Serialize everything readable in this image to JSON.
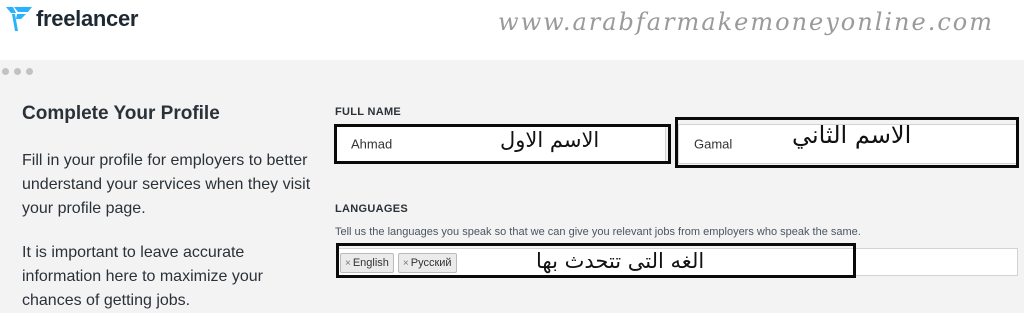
{
  "header": {
    "logo_text": "freelancer",
    "watermark": "www.arabfarmakemoneyonline.com"
  },
  "left": {
    "title": "Complete Your Profile",
    "para1": "Fill in your profile for employers to better understand your services when they visit your profile page.",
    "para2": "It is important to leave accurate information here to maximize your chances of getting jobs."
  },
  "full_name": {
    "label": "FULL NAME",
    "first_name_value": "Ahmad",
    "last_name_value": "Gamal"
  },
  "languages": {
    "label": "LANGUAGES",
    "helper": "Tell us the languages you speak so that we can give you relevant jobs from employers who speak the same.",
    "tags": [
      "English",
      "Русский"
    ]
  },
  "annotations": {
    "first_name": "الاسم الاول",
    "last_name": "الاسم الثاني",
    "languages": "الغه التى تتحدث بها"
  },
  "colors": {
    "logo_blue": "#29b2fe",
    "background": "#f3f3f3",
    "annotation_border": "#0a0a0a"
  }
}
